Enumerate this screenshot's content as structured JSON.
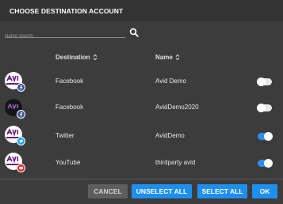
{
  "dialog": {
    "title": "CHOOSE DESTINATION ACCOUNT"
  },
  "search": {
    "placeholder": "Name search",
    "value": ""
  },
  "table": {
    "headers": {
      "destination": "Destination",
      "name": "Name"
    },
    "rows": [
      {
        "destination": "Facebook",
        "name": "Avid Demo",
        "badge": "facebook-icon",
        "enabled": false
      },
      {
        "destination": "Facebook",
        "name": "AvidDemo2020",
        "badge": "facebook-icon",
        "enabled": false
      },
      {
        "destination": "Twitter",
        "name": "AvidDemo",
        "badge": "twitter-icon",
        "enabled": true
      },
      {
        "destination": "YouTube",
        "name": "thirdparty avid",
        "badge": "youtube-icon",
        "enabled": true
      }
    ]
  },
  "footer": {
    "cancel": "CANCEL",
    "unselect_all": "UNSELECT ALL",
    "select_all": "SELECT ALL",
    "ok": "OK"
  },
  "colors": {
    "background": "#3c3c3c",
    "titlebar": "#333333",
    "accent": "#1f8fef",
    "toggle_on": "#2f8fe8",
    "facebook": "#3b5998",
    "twitter": "#1da1f2",
    "youtube": "#e62117"
  }
}
